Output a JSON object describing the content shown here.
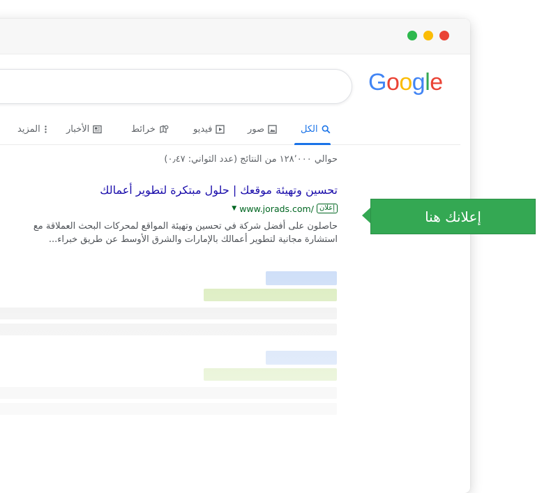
{
  "browser": {
    "window_controls": [
      "green",
      "yellow",
      "red"
    ]
  },
  "logo": {
    "letters": [
      {
        "char": "G",
        "color": "#4285f4"
      },
      {
        "char": "o",
        "color": "#ea4335"
      },
      {
        "char": "o",
        "color": "#fbbc05"
      },
      {
        "char": "g",
        "color": "#4285f4"
      },
      {
        "char": "l",
        "color": "#34a853"
      },
      {
        "char": "e",
        "color": "#ea4335"
      }
    ]
  },
  "tabs": {
    "all": "الكل",
    "images": "صور",
    "videos": "فيديو",
    "maps": "خرائط",
    "news": "الأخبار",
    "more": "المزيد"
  },
  "results": {
    "stats": "حوالي ١٢٨٬٠٠٠ من النتائج (عدد الثواني: ٠٫٤٧)",
    "ad": {
      "title": "تحسين وتهيئة موقعك | حلول مبتكرة لتطوير أعمالك",
      "badge": "إعلان",
      "url": "www.jorads.com/",
      "description_line1": "حاصلون على أفضل شركة في تحسين وتهيئة المواقع لمحركات البحث العملاقة مع",
      "description_line2": "استشارة مجانية لتطوير أعمالك بالإمارات والشرق الأوسط عن طريق خبراء..."
    }
  },
  "callout": {
    "label": "إعلانك هنا"
  },
  "colors": {
    "accent_blue": "#1a73e8",
    "link": "#1a0dab",
    "url_green": "#006621",
    "callout_green": "#34a853"
  }
}
